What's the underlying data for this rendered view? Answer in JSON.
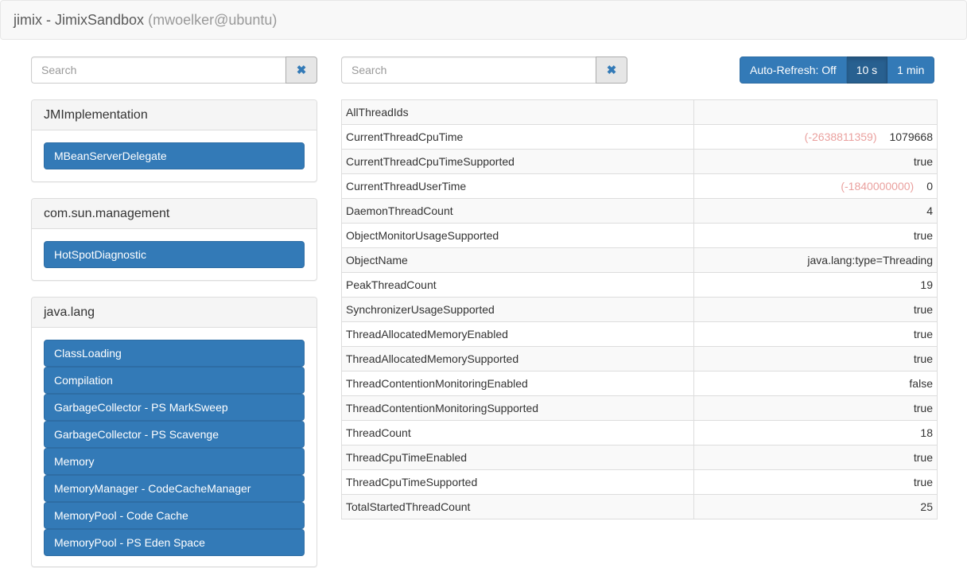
{
  "header": {
    "app": "jimix",
    "separator": " - ",
    "instance": "JimixSandbox",
    "host": "(mwoelker@ubuntu)"
  },
  "left_search": {
    "placeholder": "Search",
    "value": "",
    "clear_icon": "close-icon"
  },
  "right_search": {
    "placeholder": "Search",
    "value": "",
    "clear_icon": "close-icon"
  },
  "refresh": {
    "buttons": [
      {
        "label": "Auto-Refresh: Off",
        "active": false
      },
      {
        "label": "10 s",
        "active": true
      },
      {
        "label": "1 min",
        "active": false
      }
    ]
  },
  "domains": [
    {
      "name": "JMImplementation",
      "beans": [
        "MBeanServerDelegate"
      ]
    },
    {
      "name": "com.sun.management",
      "beans": [
        "HotSpotDiagnostic"
      ]
    },
    {
      "name": "java.lang",
      "beans": [
        "ClassLoading",
        "Compilation",
        "GarbageCollector - PS MarkSweep",
        "GarbageCollector - PS Scavenge",
        "Memory",
        "MemoryManager - CodeCacheManager",
        "MemoryPool - Code Cache",
        "MemoryPool - PS Eden Space"
      ]
    }
  ],
  "attributes": [
    {
      "name": "AllThreadIds",
      "value": "",
      "delta": ""
    },
    {
      "name": "CurrentThreadCpuTime",
      "value": "1079668",
      "delta": "(-2638811359)"
    },
    {
      "name": "CurrentThreadCpuTimeSupported",
      "value": "true",
      "delta": ""
    },
    {
      "name": "CurrentThreadUserTime",
      "value": "0",
      "delta": "(-1840000000)"
    },
    {
      "name": "DaemonThreadCount",
      "value": "4",
      "delta": ""
    },
    {
      "name": "ObjectMonitorUsageSupported",
      "value": "true",
      "delta": ""
    },
    {
      "name": "ObjectName",
      "value": "java.lang:type=Threading",
      "delta": ""
    },
    {
      "name": "PeakThreadCount",
      "value": "19",
      "delta": ""
    },
    {
      "name": "SynchronizerUsageSupported",
      "value": "true",
      "delta": ""
    },
    {
      "name": "ThreadAllocatedMemoryEnabled",
      "value": "true",
      "delta": ""
    },
    {
      "name": "ThreadAllocatedMemorySupported",
      "value": "true",
      "delta": ""
    },
    {
      "name": "ThreadContentionMonitoringEnabled",
      "value": "false",
      "delta": ""
    },
    {
      "name": "ThreadContentionMonitoringSupported",
      "value": "true",
      "delta": ""
    },
    {
      "name": "ThreadCount",
      "value": "18",
      "delta": ""
    },
    {
      "name": "ThreadCpuTimeEnabled",
      "value": "true",
      "delta": ""
    },
    {
      "name": "ThreadCpuTimeSupported",
      "value": "true",
      "delta": ""
    },
    {
      "name": "TotalStartedThreadCount",
      "value": "25",
      "delta": ""
    }
  ],
  "colors": {
    "primary": "#337ab7",
    "primary_active": "#286090",
    "delta_text": "#d9534f"
  }
}
